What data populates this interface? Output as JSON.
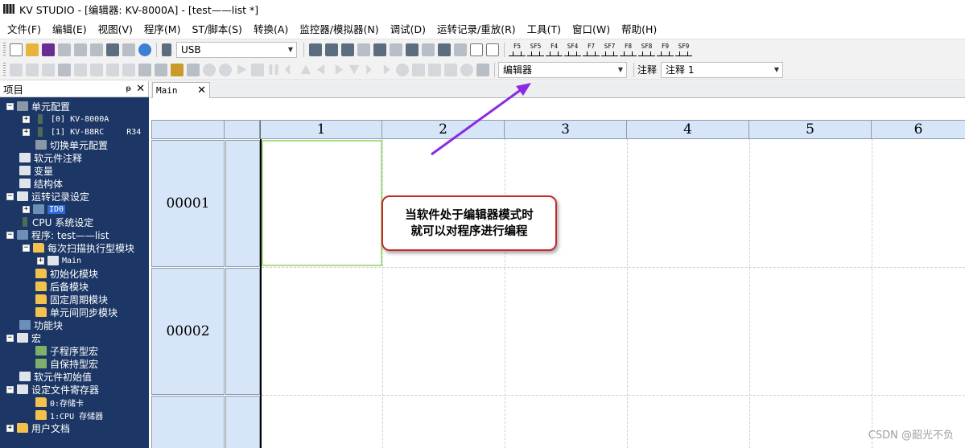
{
  "window": {
    "title": "KV STUDIO - [编辑器: KV-8000A] - [test——list *]"
  },
  "menu": [
    "文件(F)",
    "编辑(E)",
    "视图(V)",
    "程序(M)",
    "ST/脚本(S)",
    "转换(A)",
    "监控器/模拟器(N)",
    "调试(D)",
    "运转记录/重放(R)",
    "工具(T)",
    "窗口(W)",
    "帮助(H)"
  ],
  "toolbar1": {
    "connection_value": "USB",
    "fkeys": [
      "F5",
      "SF5",
      "F4",
      "SF4",
      "F7",
      "SF7",
      "F8",
      "SF8",
      "F9",
      "SF9"
    ]
  },
  "toolbar2": {
    "mode_value": "编辑器",
    "comment_label": "注释",
    "comment_value": "注释 1"
  },
  "pane": {
    "title": "项目",
    "pin": "ᵽ",
    "close": "✕",
    "tree": {
      "unit_config": "单元配置",
      "unit0": "[0]  KV-8000A",
      "unit1": "[1]  KV-B8RC",
      "unit1_suffix": "R34",
      "switch_unit": "切换单元配置",
      "device_comment": "软元件注释",
      "variables": "变量",
      "struct": "结构体",
      "oplog": "运转记录设定",
      "ido": "ID0",
      "cpu": "CPU 系统设定",
      "program": "程序: test——list",
      "scan_module": "每次扫描执行型模块",
      "main": "Main",
      "init_module": "初始化模块",
      "standby_module": "后备模块",
      "fixed_module": "固定周期模块",
      "sync_module": "单元间同步模块",
      "function_block": "功能块",
      "macro": "宏",
      "sub_macro": "子程序型宏",
      "self_macro": "自保持型宏",
      "device_init": "软元件初始值",
      "file_register": "设定文件寄存器",
      "card": "0:存储卡",
      "cpu_mem": "1:CPU 存储器",
      "user_docs": "用户文档"
    }
  },
  "editor": {
    "tab_label": "Main",
    "tab_close": "✕",
    "columns": [
      "1",
      "2",
      "3",
      "4",
      "5",
      "6"
    ],
    "rows": [
      "00001",
      "00002"
    ]
  },
  "callout": {
    "line1": "当软件处于编辑器模式时",
    "line2": "就可以对程序进行编程"
  },
  "watermark": "CSDN @韶光不负",
  "colors": {
    "tree_bg": "#1c3765",
    "header_bg": "#d6e5f7",
    "arrow": "#8a2be2",
    "callout_border": "#c62828",
    "cursor": "#a8df86"
  }
}
